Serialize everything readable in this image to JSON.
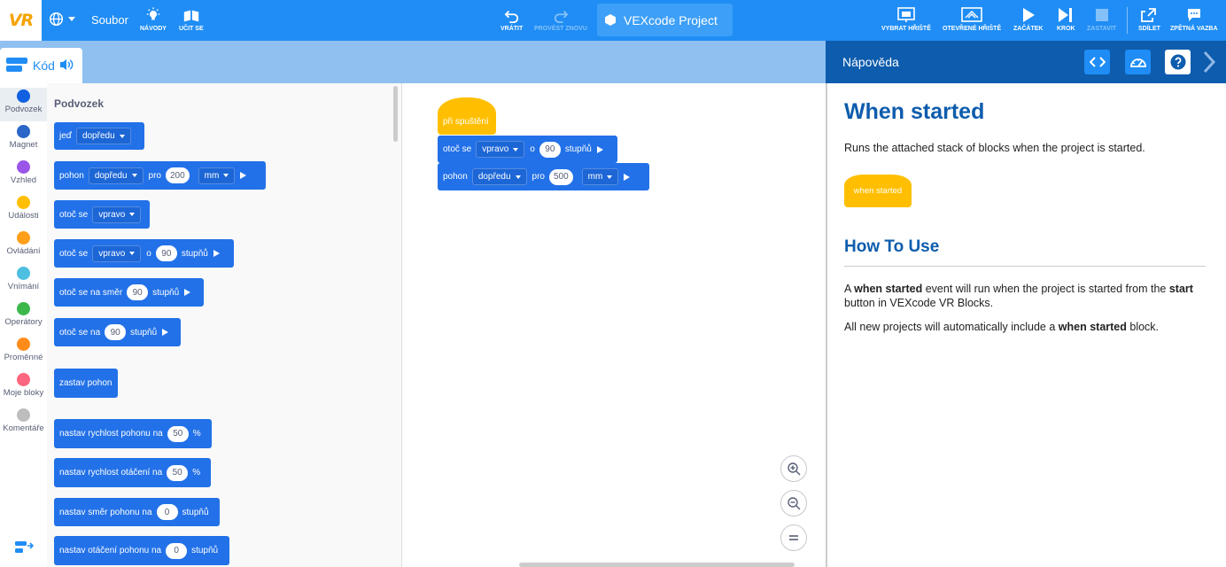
{
  "topbar": {
    "logo": "VR",
    "file_menu": "Soubor",
    "tutorials": "NÁVODY",
    "teach": "UČIT SE",
    "undo": "VRÁTIT",
    "redo": "PROVÉST ZNOVU",
    "project_name": "VEXcode Project",
    "select_playground": "VYBRAT HŘIŠTĚ",
    "open_playground": "OTEVŘENÉ HŘIŠTĚ",
    "start": "ZAČÁTEK",
    "step": "KROK",
    "stop": "ZASTAVIT",
    "share": "SDÍLET",
    "feedback": "ZPĚTNÁ VAZBA"
  },
  "tab": {
    "label": "Kód"
  },
  "categories": [
    {
      "label": "Podvozek",
      "color": "#1060e0"
    },
    {
      "label": "Magnet",
      "color": "#2a67c8"
    },
    {
      "label": "Vzhled",
      "color": "#9a55e8"
    },
    {
      "label": "Události",
      "color": "#ffbf00"
    },
    {
      "label": "Ovládání",
      "color": "#ff9f1a"
    },
    {
      "label": "Vnímání",
      "color": "#4dbfe0"
    },
    {
      "label": "Operátory",
      "color": "#3cb84a"
    },
    {
      "label": "Proměnné",
      "color": "#ff8c1a"
    },
    {
      "label": "Moje bloky",
      "color": "#ff6680"
    },
    {
      "label": "Komentáře",
      "color": "#bdbdbd"
    }
  ],
  "flyout": {
    "title": "Podvozek",
    "b1": {
      "t1": "jeď",
      "d1": "dopředu"
    },
    "b2": {
      "t1": "pohon",
      "d1": "dopředu",
      "t2": "pro",
      "n1": "200",
      "d2": "mm"
    },
    "b3": {
      "t1": "otoč se",
      "d1": "vpravo"
    },
    "b4": {
      "t1": "otoč se",
      "d1": "vpravo",
      "t2": "o",
      "n1": "90",
      "t3": "stupňů"
    },
    "b5": {
      "t1": "otoč se na směr",
      "n1": "90",
      "t2": "stupňů"
    },
    "b6": {
      "t1": "otoč se na",
      "n1": "90",
      "t2": "stupňů"
    },
    "b7": {
      "t1": "zastav pohon"
    },
    "b8": {
      "t1": "nastav rychlost pohonu na",
      "n1": "50",
      "t2": "%"
    },
    "b9": {
      "t1": "nastav rychlost otáčení na",
      "n1": "50",
      "t2": "%"
    },
    "b10": {
      "t1": "nastav směr pohonu na",
      "n1": "0",
      "t2": "stupňů"
    },
    "b11": {
      "t1": "nastav otáčení pohonu na",
      "n1": "0",
      "t2": "stupňů"
    }
  },
  "workspace": {
    "hat": "při spuštění",
    "s1": {
      "t1": "otoč se",
      "d1": "vpravo",
      "t2": "o",
      "n1": "90",
      "t3": "stupňů"
    },
    "s2": {
      "t1": "pohon",
      "d1": "dopředu",
      "t2": "pro",
      "n1": "500",
      "d2": "mm"
    }
  },
  "help": {
    "header": "Nápověda",
    "title": "When started",
    "intro": "Runs the attached stack of blocks when the project is started.",
    "sample_block": "when started",
    "howto_title": "How To Use",
    "p_a": "A ",
    "p_b": "when started",
    "p_c": " event will run when the project is started from the ",
    "p_d": "start",
    "p_e": " button in VEXcode VR Blocks.",
    "q_a": "All new projects will automatically include a ",
    "q_b": "when started",
    "q_c": " block."
  },
  "colors": {
    "topbar": "#1f8df5",
    "motion": "#2271e8",
    "events": "#ffbf00",
    "help_header": "#0e5cad"
  }
}
